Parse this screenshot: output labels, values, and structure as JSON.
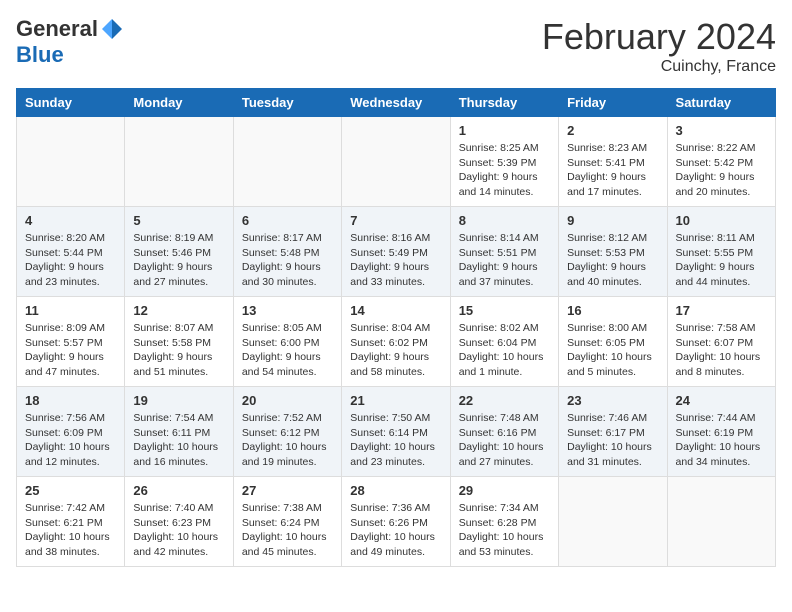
{
  "header": {
    "logo_general": "General",
    "logo_blue": "Blue",
    "month_title": "February 2024",
    "location": "Cuinchy, France"
  },
  "days_of_week": [
    "Sunday",
    "Monday",
    "Tuesday",
    "Wednesday",
    "Thursday",
    "Friday",
    "Saturday"
  ],
  "weeks": [
    {
      "shaded": false,
      "days": [
        {
          "num": "",
          "info": ""
        },
        {
          "num": "",
          "info": ""
        },
        {
          "num": "",
          "info": ""
        },
        {
          "num": "",
          "info": ""
        },
        {
          "num": "1",
          "info": "Sunrise: 8:25 AM\nSunset: 5:39 PM\nDaylight: 9 hours and 14 minutes."
        },
        {
          "num": "2",
          "info": "Sunrise: 8:23 AM\nSunset: 5:41 PM\nDaylight: 9 hours and 17 minutes."
        },
        {
          "num": "3",
          "info": "Sunrise: 8:22 AM\nSunset: 5:42 PM\nDaylight: 9 hours and 20 minutes."
        }
      ]
    },
    {
      "shaded": true,
      "days": [
        {
          "num": "4",
          "info": "Sunrise: 8:20 AM\nSunset: 5:44 PM\nDaylight: 9 hours and 23 minutes."
        },
        {
          "num": "5",
          "info": "Sunrise: 8:19 AM\nSunset: 5:46 PM\nDaylight: 9 hours and 27 minutes."
        },
        {
          "num": "6",
          "info": "Sunrise: 8:17 AM\nSunset: 5:48 PM\nDaylight: 9 hours and 30 minutes."
        },
        {
          "num": "7",
          "info": "Sunrise: 8:16 AM\nSunset: 5:49 PM\nDaylight: 9 hours and 33 minutes."
        },
        {
          "num": "8",
          "info": "Sunrise: 8:14 AM\nSunset: 5:51 PM\nDaylight: 9 hours and 37 minutes."
        },
        {
          "num": "9",
          "info": "Sunrise: 8:12 AM\nSunset: 5:53 PM\nDaylight: 9 hours and 40 minutes."
        },
        {
          "num": "10",
          "info": "Sunrise: 8:11 AM\nSunset: 5:55 PM\nDaylight: 9 hours and 44 minutes."
        }
      ]
    },
    {
      "shaded": false,
      "days": [
        {
          "num": "11",
          "info": "Sunrise: 8:09 AM\nSunset: 5:57 PM\nDaylight: 9 hours and 47 minutes."
        },
        {
          "num": "12",
          "info": "Sunrise: 8:07 AM\nSunset: 5:58 PM\nDaylight: 9 hours and 51 minutes."
        },
        {
          "num": "13",
          "info": "Sunrise: 8:05 AM\nSunset: 6:00 PM\nDaylight: 9 hours and 54 minutes."
        },
        {
          "num": "14",
          "info": "Sunrise: 8:04 AM\nSunset: 6:02 PM\nDaylight: 9 hours and 58 minutes."
        },
        {
          "num": "15",
          "info": "Sunrise: 8:02 AM\nSunset: 6:04 PM\nDaylight: 10 hours and 1 minute."
        },
        {
          "num": "16",
          "info": "Sunrise: 8:00 AM\nSunset: 6:05 PM\nDaylight: 10 hours and 5 minutes."
        },
        {
          "num": "17",
          "info": "Sunrise: 7:58 AM\nSunset: 6:07 PM\nDaylight: 10 hours and 8 minutes."
        }
      ]
    },
    {
      "shaded": true,
      "days": [
        {
          "num": "18",
          "info": "Sunrise: 7:56 AM\nSunset: 6:09 PM\nDaylight: 10 hours and 12 minutes."
        },
        {
          "num": "19",
          "info": "Sunrise: 7:54 AM\nSunset: 6:11 PM\nDaylight: 10 hours and 16 minutes."
        },
        {
          "num": "20",
          "info": "Sunrise: 7:52 AM\nSunset: 6:12 PM\nDaylight: 10 hours and 19 minutes."
        },
        {
          "num": "21",
          "info": "Sunrise: 7:50 AM\nSunset: 6:14 PM\nDaylight: 10 hours and 23 minutes."
        },
        {
          "num": "22",
          "info": "Sunrise: 7:48 AM\nSunset: 6:16 PM\nDaylight: 10 hours and 27 minutes."
        },
        {
          "num": "23",
          "info": "Sunrise: 7:46 AM\nSunset: 6:17 PM\nDaylight: 10 hours and 31 minutes."
        },
        {
          "num": "24",
          "info": "Sunrise: 7:44 AM\nSunset: 6:19 PM\nDaylight: 10 hours and 34 minutes."
        }
      ]
    },
    {
      "shaded": false,
      "days": [
        {
          "num": "25",
          "info": "Sunrise: 7:42 AM\nSunset: 6:21 PM\nDaylight: 10 hours and 38 minutes."
        },
        {
          "num": "26",
          "info": "Sunrise: 7:40 AM\nSunset: 6:23 PM\nDaylight: 10 hours and 42 minutes."
        },
        {
          "num": "27",
          "info": "Sunrise: 7:38 AM\nSunset: 6:24 PM\nDaylight: 10 hours and 45 minutes."
        },
        {
          "num": "28",
          "info": "Sunrise: 7:36 AM\nSunset: 6:26 PM\nDaylight: 10 hours and 49 minutes."
        },
        {
          "num": "29",
          "info": "Sunrise: 7:34 AM\nSunset: 6:28 PM\nDaylight: 10 hours and 53 minutes."
        },
        {
          "num": "",
          "info": ""
        },
        {
          "num": "",
          "info": ""
        }
      ]
    }
  ]
}
